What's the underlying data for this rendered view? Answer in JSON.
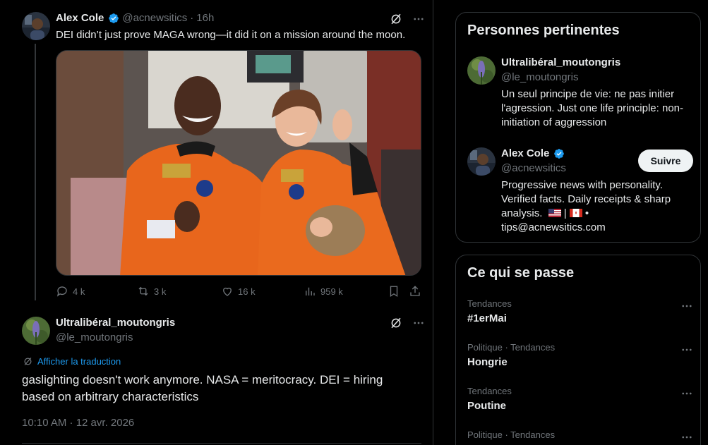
{
  "tweet": {
    "author_name": "Alex Cole",
    "author_handle": "@acnewsitics",
    "separator": "·",
    "time": "16h",
    "text": "DEI didn’t just prove MAGA wrong—it did it on a mission around the moon.",
    "more_icon": "more-icon",
    "grok_icon": "grok-icon",
    "stats": {
      "replies": "4 k",
      "reposts": "3 k",
      "likes": "16 k",
      "views": "959 k"
    }
  },
  "reply": {
    "author_name": "Ultralibéral_moutongris",
    "author_handle": "@le_moutongris",
    "translate_label": "Afficher la traduction",
    "text": "gaslighting doesn't work anymore. NASA = meritocracy. DEI = hiring based on arbitrary characteristics",
    "timestamp": "10:10 AM · 12 avr. 2026"
  },
  "relevant_people": {
    "title": "Personnes pertinentes",
    "people": [
      {
        "name": "Ultralibéral_moutongris",
        "handle": "@le_moutongris",
        "bio": "Un seul principe de vie: ne pas initier l'agression. Just one life principle: non-initiation of aggression"
      },
      {
        "name": "Alex Cole",
        "handle": "@acnewsitics",
        "follow_label": "Suivre",
        "bio_line1": "Progressive news with personality. Verified facts. Daily receipts & sharp analysis.",
        "bio_sep": " | ",
        "bio_dot": " •",
        "bio_line2": "tips@acnewsitics.com"
      }
    ]
  },
  "whats_happening": {
    "title": "Ce qui se passe",
    "trends": [
      {
        "category": "Tendances",
        "name": "#1erMai"
      },
      {
        "category": "Politique · Tendances",
        "name": "Hongrie"
      },
      {
        "category": "Tendances",
        "name": "Poutine"
      },
      {
        "category": "Politique · Tendances",
        "name": ""
      }
    ]
  },
  "colors": {
    "accent": "#1d9bf0",
    "verified": "#1d9bf0",
    "secondary_text": "#71767b",
    "border": "#2f3336"
  }
}
